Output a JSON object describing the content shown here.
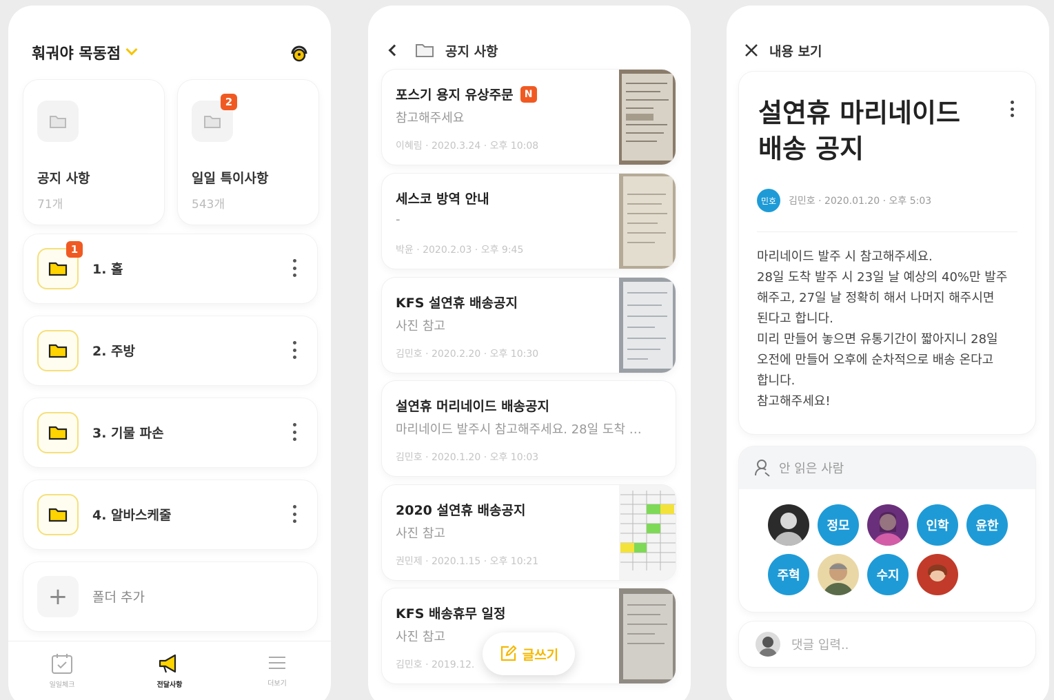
{
  "panel1": {
    "store_name": "훠궈야 목동점",
    "categories": [
      {
        "title": "공지 사항",
        "count": "71개"
      },
      {
        "title": "일일 특이사항",
        "count": "543개",
        "badge": "2"
      }
    ],
    "folders": [
      {
        "label": "1. 홀",
        "badge": "1"
      },
      {
        "label": "2. 주방"
      },
      {
        "label": "3. 기물 파손"
      },
      {
        "label": "4. 알바스케줄"
      }
    ],
    "add_folder": "폴더 추가",
    "nav": [
      "일일체크",
      "전달사항",
      "더보기"
    ]
  },
  "panel2": {
    "title": "공지 사항",
    "posts": [
      {
        "title": "포스기 용지 유상주문",
        "badge": "N",
        "body": "참고해주세요",
        "meta": "이혜림 · 2020.3.24 · 오후 10:08"
      },
      {
        "title": "세스코 방역 안내",
        "body": "-",
        "meta": "박윤 · 2020.2.03 · 오후 9:45"
      },
      {
        "title": "KFS 설연휴 배송공지",
        "body": "사진 참고",
        "meta": "김민호 · 2020.2.20 · 오후 10:30"
      },
      {
        "title": "설연휴 머리네이드 배송공지",
        "body": "마리네이드 발주시 참고해주세요. 28일 도착 …",
        "meta": "김민호 · 2020.1.20 · 오후 10:03"
      },
      {
        "title": "2020 설연휴 배송공지",
        "body": "사진 참고",
        "meta": "권민제 · 2020.1.15 · 오후 10:21"
      },
      {
        "title": "KFS 배송휴무 일정",
        "body": "사진 참고",
        "meta": "김민호 · 2019.12."
      }
    ],
    "write_button": "글쓰기"
  },
  "panel3": {
    "header_title": "내용 보기",
    "title": "설연휴 마리네이드 배송 공지",
    "author_initial": "민호",
    "author_meta": "김민호 · 2020.01.20 · 오후 5:03",
    "body_lines": [
      "마리네이드 발주 시 참고해주세요.",
      "28일 도착 발주 시 23일 날 예상의 40%만 발주",
      "해주고, 27일 날 정확히 해서 나머지 해주시면",
      "된다고 합니다.",
      "미리 만들어 놓으면 유통기간이 짧아지니 28일",
      "오전에 만들어 오후에 순차적으로 배송 온다고",
      "합니다.",
      "참고해주세요!"
    ],
    "unread_label": "안 읽은 사람",
    "unread_users": [
      "정모",
      "인학",
      "윤한",
      "주혁",
      "수지"
    ],
    "comment_placeholder": "댓글 입력.."
  },
  "colors": {
    "accent_yellow": "#f5c400",
    "badge_orange": "#f05a22",
    "avatar_blue": "#1e9bd7"
  }
}
